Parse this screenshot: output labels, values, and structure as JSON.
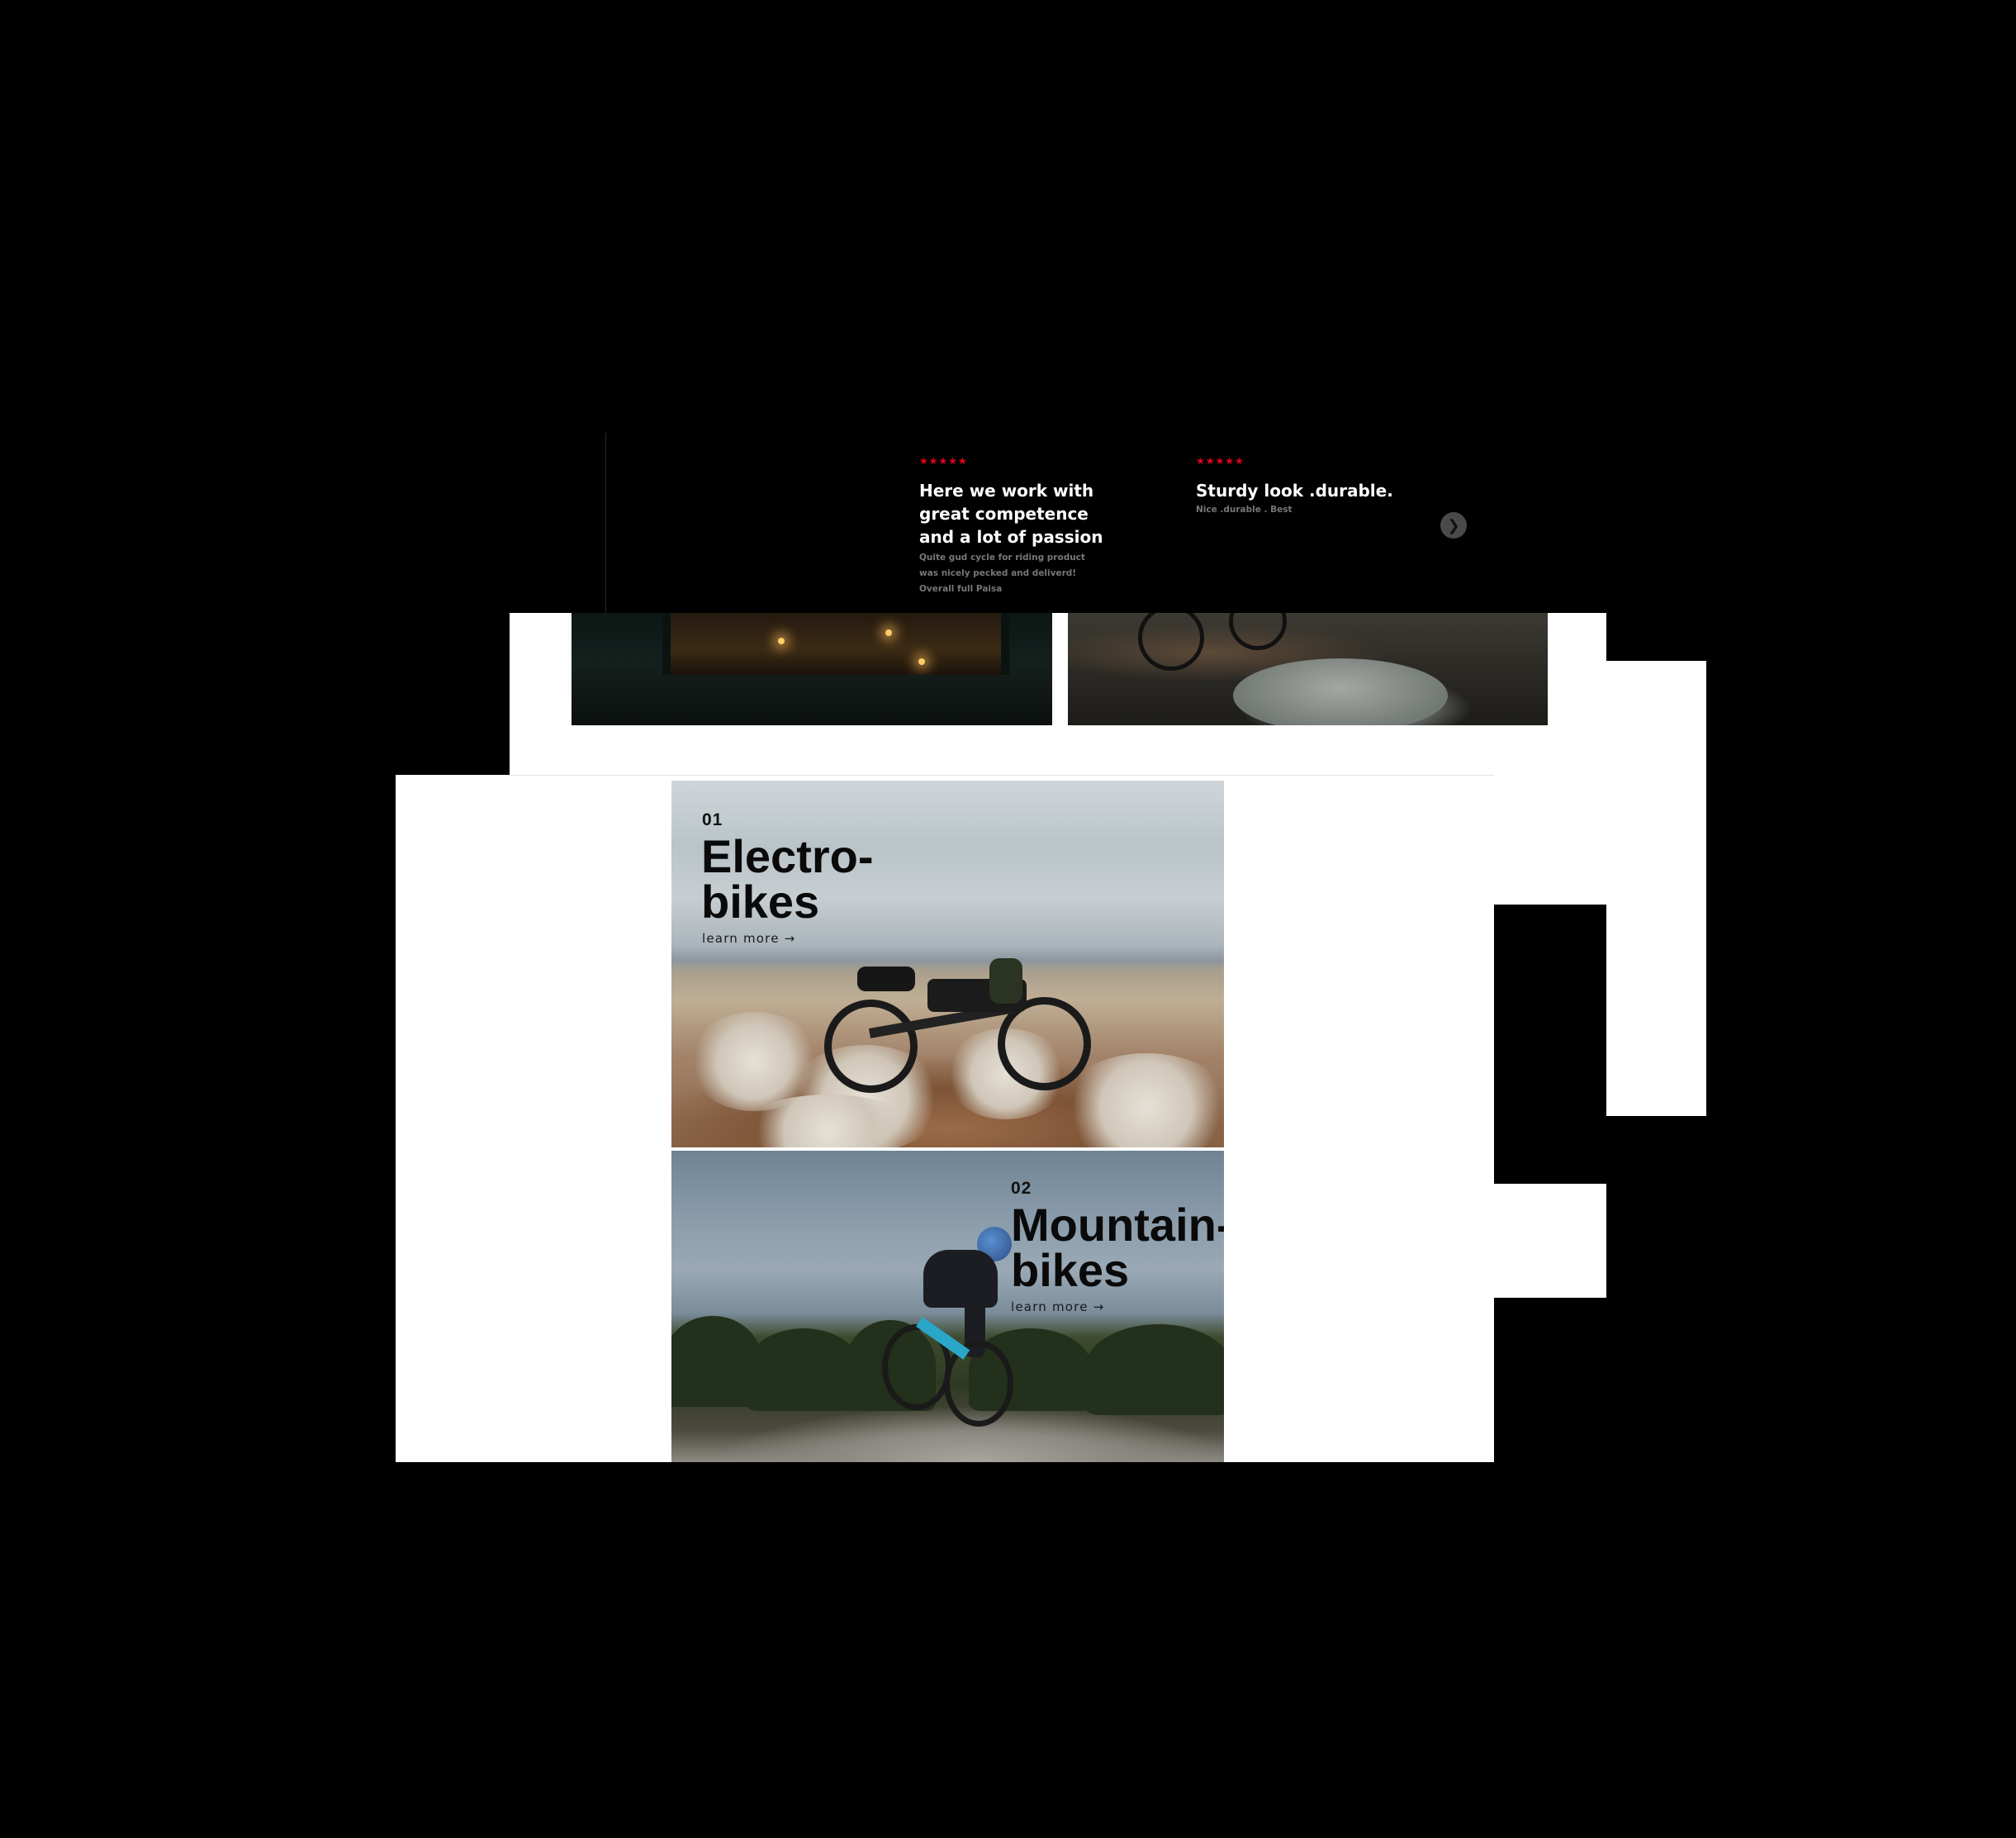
{
  "testimonials": {
    "items": [
      {
        "stars": "★★★★★",
        "title": "Here we work with great competence and a lot of passion",
        "body": "Quite gud cycle for riding product was nicely pecked and deliverd! Overall full Paisa"
      },
      {
        "stars": "★★★★★",
        "title": "Sturdy look .durable.",
        "body": "Nice .durable . Best"
      }
    ],
    "next_glyph": "❯"
  },
  "categories": [
    {
      "number": "01",
      "title": "Electro-\nbikes",
      "link": "learn more →"
    },
    {
      "number": "02",
      "title": "Mountain-\nbikes",
      "link": "learn more →"
    }
  ],
  "colors": {
    "star_color": "#e5001c",
    "band_background": "#000000",
    "panel_background": "#ffffff"
  }
}
